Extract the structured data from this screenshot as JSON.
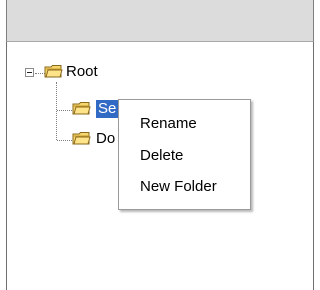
{
  "tree": {
    "root": {
      "label": "Root",
      "expanded": true
    },
    "children": [
      {
        "label": "Se",
        "selected": true
      },
      {
        "label": "Do",
        "selected": false
      }
    ]
  },
  "context_menu": {
    "items": [
      {
        "label": "Rename"
      },
      {
        "label": "Delete"
      },
      {
        "label": "New Folder"
      }
    ]
  },
  "colors": {
    "selection": "#316ac5",
    "header": "#dcdcdc",
    "folder_body": "#f4d36a",
    "folder_outline": "#8a6a1c"
  },
  "icons": {
    "expander": "minus-box-icon",
    "folder": "folder-icon"
  }
}
